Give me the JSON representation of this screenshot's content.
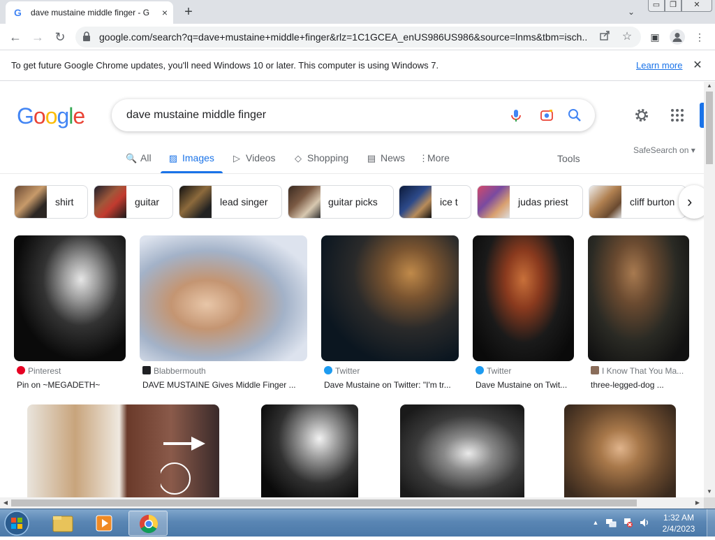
{
  "browser": {
    "tab": {
      "favicon": "google-g-icon",
      "title": "dave mustaine middle finger - Google Search",
      "close_glyph": "×"
    },
    "new_tab_glyph": "+",
    "tab_search_glyph": "⌄",
    "window": {
      "min": "▭",
      "max": "❐",
      "close": "✕"
    },
    "nav": {
      "back": "←",
      "forward": "→",
      "reload": "↻"
    },
    "url": "google.com/search?q=dave+mustaine+middle+finger&rlz=1C1GCEA_enUS986US986&source=lnms&tbm=isch...",
    "toolbar_icons": {
      "side_panel": "▣",
      "profile": "●",
      "menu": "⋮"
    }
  },
  "infobar": {
    "message": "To get future Google Chrome updates, you'll need Windows 10 or later. This computer is using Windows 7.",
    "link": "Learn more",
    "close": "✕"
  },
  "google": {
    "logo": {
      "l1": "G",
      "l2": "o",
      "l3": "o",
      "l4": "g",
      "l5": "l",
      "l6": "e"
    },
    "query": "dave mustaine middle finger",
    "tabs": [
      {
        "label": "All",
        "icon": "🔍"
      },
      {
        "label": "Images",
        "icon": "▨"
      },
      {
        "label": "Videos",
        "icon": "▷"
      },
      {
        "label": "Shopping",
        "icon": "◇"
      },
      {
        "label": "News",
        "icon": "▤"
      },
      {
        "label": "More",
        "icon": "⋮"
      }
    ],
    "tools": "Tools",
    "safesearch": "SafeSearch on ▾",
    "chips": [
      "shirt",
      "guitar",
      "lead singer",
      "guitar picks",
      "ice t",
      "judas priest",
      "cliff burton"
    ],
    "chip_next": "›",
    "results": [
      {
        "source": "Pinterest",
        "title": "Pin on ~MEGADETH~",
        "fav_color": "#e60023"
      },
      {
        "source": "Blabbermouth",
        "title": "DAVE MUSTAINE Gives Middle Finger ...",
        "fav_color": "#202124"
      },
      {
        "source": "Twitter",
        "title": "Dave Mustaine on Twitter: \"I'm tr...",
        "fav_color": "#1d9bf0"
      },
      {
        "source": "Twitter",
        "title": "Dave Mustaine on Twit...",
        "fav_color": "#1d9bf0"
      },
      {
        "source": "I Know That You Ma...",
        "title": "three-legged-dog ...",
        "fav_color": "#8a6d5a"
      }
    ]
  },
  "scroll": {
    "up": "▲",
    "down": "▼",
    "left": "◀",
    "right": "▶"
  },
  "taskbar": {
    "tray_arrow": "▲",
    "time": "1:32 AM",
    "date": "2/4/2023"
  }
}
